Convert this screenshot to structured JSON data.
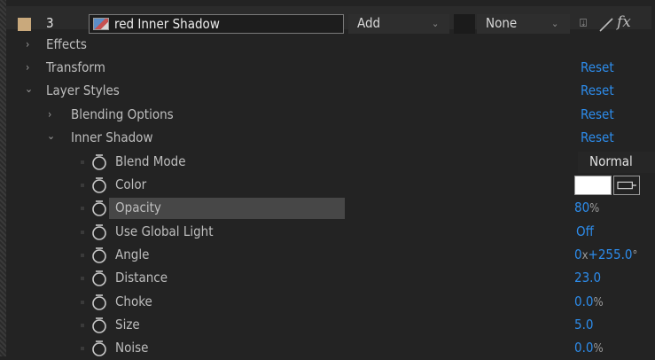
{
  "header": {
    "layer_number": "3",
    "layer_name": "red Inner Shadow",
    "mode_label": "Add",
    "parent_label": "None",
    "fx_label": "fx"
  },
  "rows": {
    "effects": {
      "label": "Effects"
    },
    "transform": {
      "label": "Transform",
      "reset": "Reset"
    },
    "layer_styles": {
      "label": "Layer Styles",
      "reset": "Reset"
    },
    "blending_options": {
      "label": "Blending Options",
      "reset": "Reset"
    },
    "inner_shadow": {
      "label": "Inner Shadow",
      "reset": "Reset"
    },
    "blend_mode": {
      "label": "Blend Mode",
      "value": "Normal"
    },
    "color": {
      "label": "Color",
      "swatch_color": "#ffffff"
    },
    "opacity": {
      "label": "Opacity",
      "value": "80",
      "unit": "%"
    },
    "use_global_light": {
      "label": "Use Global Light",
      "value": "Off"
    },
    "angle": {
      "label": "Angle",
      "value_a": "0",
      "value_b": "+255.0",
      "unit_x": "x",
      "unit_deg": "°"
    },
    "distance": {
      "label": "Distance",
      "value": "23.0"
    },
    "choke": {
      "label": "Choke",
      "value": "0.0",
      "unit": "%"
    },
    "size": {
      "label": "Size",
      "value": "5.0"
    },
    "noise": {
      "label": "Noise",
      "value": "0.0",
      "unit": "%"
    }
  },
  "colors": {
    "accent_blue": "#2d8ceb",
    "background": "#232323",
    "highlight_row": "#474747",
    "label_swatch": "#c9a97c"
  },
  "icons": [
    "chevron-right-icon",
    "chevron-down-icon",
    "stopwatch-icon",
    "layer-thumbnail-icon",
    "motion-blur-icon",
    "pen-icon",
    "eyedropper-icon"
  ]
}
